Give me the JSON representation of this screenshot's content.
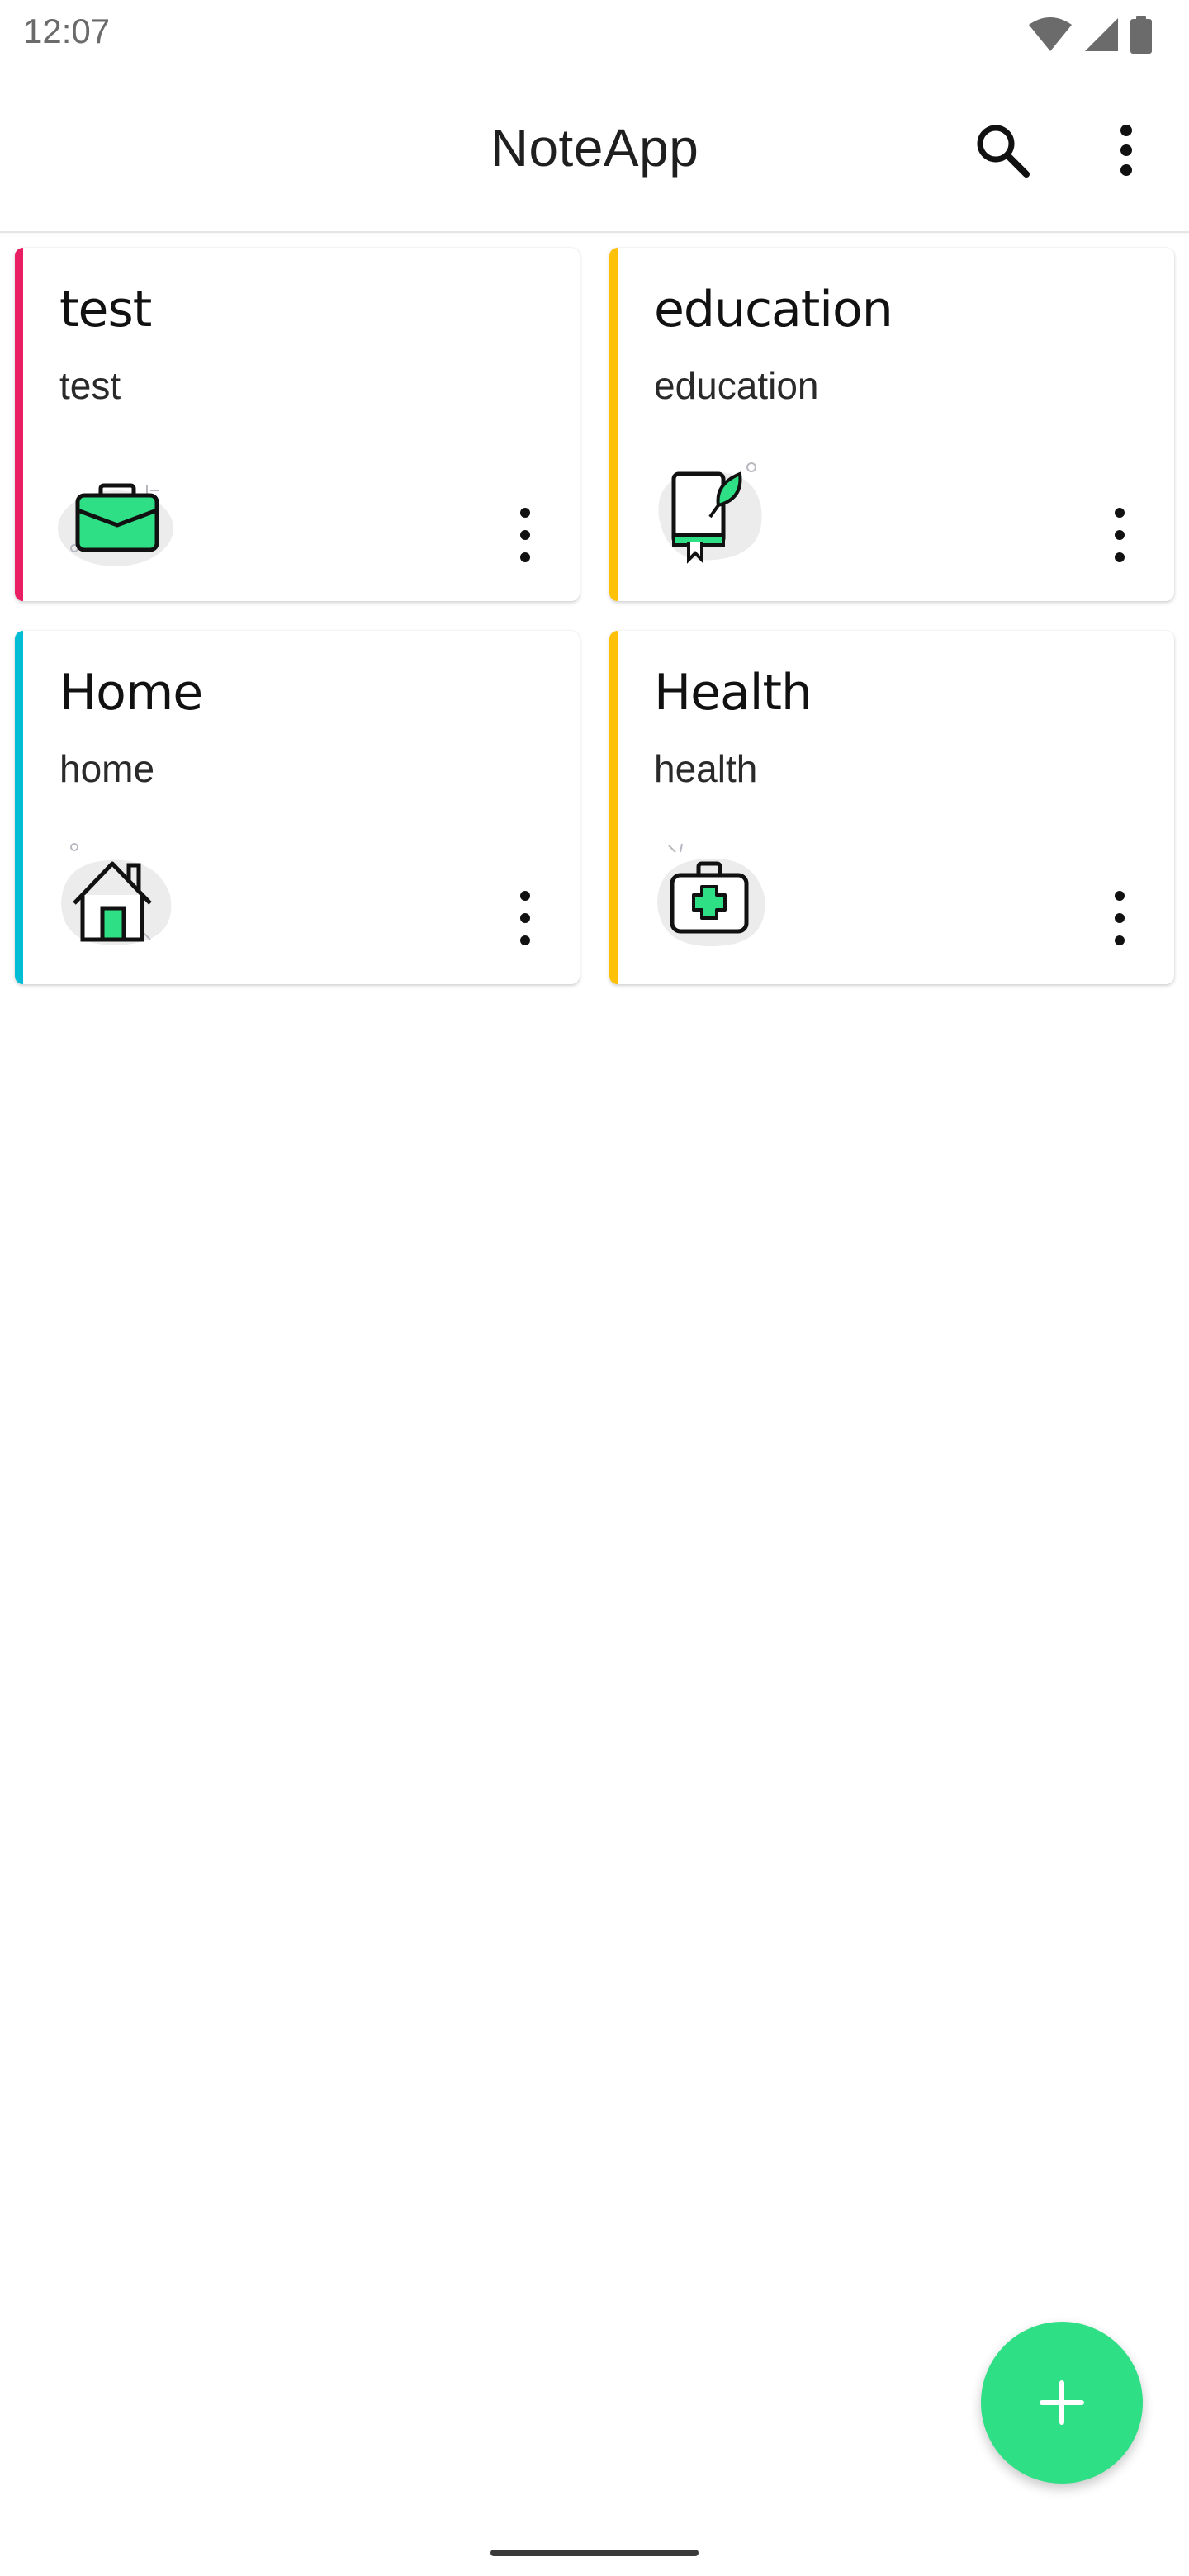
{
  "status_bar": {
    "time": "12:07",
    "icons": [
      "wifi-icon",
      "cellular-signal-icon",
      "battery-icon"
    ]
  },
  "app_bar": {
    "title": "NoteApp",
    "actions": [
      "search-icon",
      "more-vertical-icon"
    ]
  },
  "categories": [
    {
      "title": "test",
      "subtitle": "test",
      "accent_color": "#e91e63",
      "icon": "briefcase-icon"
    },
    {
      "title": "education",
      "subtitle": "education",
      "accent_color": "#ffc107",
      "icon": "book-leaf-icon"
    },
    {
      "title": "Home",
      "subtitle": "home",
      "accent_color": "#00bcd4",
      "icon": "house-icon"
    },
    {
      "title": "Health",
      "subtitle": "health",
      "accent_color": "#ffc107",
      "icon": "first-aid-kit-icon"
    }
  ],
  "fab": {
    "icon": "plus-icon",
    "color": "#2fdf85"
  },
  "colors": {
    "icon_green": "#2fdf85",
    "icon_bg": "#ececec"
  }
}
